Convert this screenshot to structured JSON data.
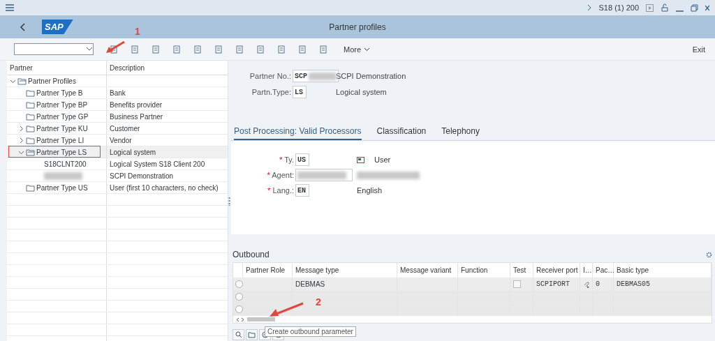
{
  "topbar": {
    "system": "S18 (1) 200"
  },
  "header": {
    "logo": "SAP",
    "title": "Partner profiles"
  },
  "toolbar": {
    "more": "More",
    "exit": "Exit"
  },
  "tree": {
    "columns": [
      "Partner",
      "Description"
    ],
    "items": [
      {
        "label": "Partner Profiles",
        "kind": "folder",
        "expanded": true,
        "selected": false,
        "children": [
          {
            "label": "Partner Type B",
            "description": "Bank",
            "kind": "folder",
            "expanded": false,
            "selected": false
          },
          {
            "label": "Partner Type BP",
            "description": "Benefits provider",
            "kind": "folder",
            "expanded": false,
            "selected": false
          },
          {
            "label": "Partner Type GP",
            "description": "Business Partner",
            "kind": "folder",
            "expanded": false,
            "selected": false
          },
          {
            "label": "Partner Type KU",
            "description": "Customer",
            "kind": "folder",
            "expanded": false,
            "has_children": true,
            "selected": false
          },
          {
            "label": "Partner Type LI",
            "description": "Vendor",
            "kind": "folder",
            "expanded": false,
            "has_children": true,
            "selected": false
          },
          {
            "label": "Partner Type LS",
            "description": "Logical system",
            "kind": "folder",
            "expanded": true,
            "selected": true,
            "children": [
              {
                "label": "S18CLNT200",
                "description": "Logical System S18 Client 200",
                "kind": "leaf",
                "selected": false
              },
              {
                "description": "SCPI Demonstration",
                "kind": "redacted",
                "selected": false
              }
            ]
          },
          {
            "label": "Partner Type US",
            "description": "User (first 10 characters, no check)",
            "kind": "folder",
            "expanded": false,
            "selected": false
          }
        ]
      }
    ]
  },
  "header_fields": [
    {
      "label": "Partner No.:",
      "value": "SCP",
      "description": "SCPI Demonstration",
      "redacted": true
    },
    {
      "label": "Partn.Type:",
      "value": "LS",
      "description": "Logical system",
      "redacted": false
    }
  ],
  "tabs": [
    {
      "label": "Post Processing: Valid Processors",
      "selected": true
    },
    {
      "label": "Classification",
      "selected": false
    },
    {
      "label": "Telephony",
      "selected": false
    }
  ],
  "processor_fields": [
    {
      "required_mark": "*",
      "label": "Ty.",
      "value": "US",
      "description": "User",
      "kind": "type"
    },
    {
      "required_mark": "*",
      "label": "Agent:",
      "kind": "redacted"
    },
    {
      "required_mark": "*",
      "label": "Lang.:",
      "value": "EN",
      "description": "English",
      "kind": "plain"
    }
  ],
  "outbound": {
    "title": "Outbound",
    "columns": [
      "Partner Role",
      "Message type",
      "Message variant",
      "Function",
      "Test",
      "Receiver port",
      "I…",
      "Pac…",
      "Basic type"
    ],
    "rows": [
      {
        "selected": false,
        "message_type": "DEBMAS",
        "test": false,
        "receiver_port": "SCPIPORT",
        "pack": "0",
        "basic_type": "DEBMAS05",
        "empty": false
      },
      {
        "selected": false,
        "empty": true
      },
      {
        "selected": false,
        "empty": true
      }
    ],
    "tooltip": "Create outbound parameter"
  },
  "annotations": [
    "1",
    "2"
  ]
}
